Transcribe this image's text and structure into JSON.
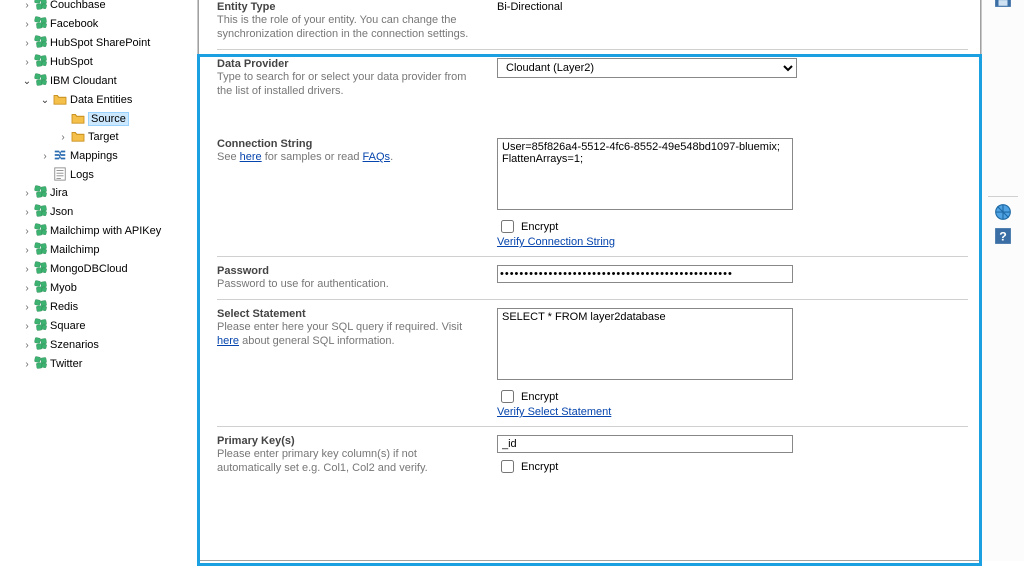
{
  "tree": {
    "nodes": [
      {
        "label": "Couchbase",
        "icon": "green",
        "expandable": true
      },
      {
        "label": "Facebook",
        "icon": "green",
        "expandable": true
      },
      {
        "label": "HubSpot SharePoint",
        "icon": "green",
        "expandable": true
      },
      {
        "label": "HubSpot",
        "icon": "green",
        "expandable": true
      },
      {
        "label": "IBM Cloudant",
        "icon": "green",
        "expandable": true,
        "open": true,
        "children": [
          {
            "label": "Data Entities",
            "icon": "folder",
            "expandable": true,
            "open": true,
            "children": [
              {
                "label": "Source",
                "icon": "folder",
                "selected": true
              },
              {
                "label": "Target",
                "icon": "folder",
                "expandable": true
              }
            ]
          },
          {
            "label": "Mappings",
            "icon": "map",
            "expandable": true
          },
          {
            "label": "Logs",
            "icon": "log",
            "expandable": false
          }
        ]
      },
      {
        "label": "Jira",
        "icon": "green",
        "expandable": true
      },
      {
        "label": "Json",
        "icon": "green",
        "expandable": true
      },
      {
        "label": "Mailchimp with APIKey",
        "icon": "green",
        "expandable": true
      },
      {
        "label": "Mailchimp",
        "icon": "green",
        "expandable": true
      },
      {
        "label": "MongoDBCloud",
        "icon": "green",
        "expandable": true
      },
      {
        "label": "Myob",
        "icon": "green",
        "expandable": true
      },
      {
        "label": "Redis",
        "icon": "green",
        "expandable": true
      },
      {
        "label": "Square",
        "icon": "green",
        "expandable": true
      },
      {
        "label": "Szenarios",
        "icon": "green",
        "expandable": true
      },
      {
        "label": "Twitter",
        "icon": "green",
        "expandable": true
      }
    ]
  },
  "form": {
    "entity_type": {
      "title": "Entity Type",
      "desc": "This is the role of your entity. You can change the synchronization direction in the connection settings.",
      "value": "Bi-Directional"
    },
    "data_provider": {
      "title": "Data Provider",
      "desc": "Type to search for or select your data provider from the list of installed drivers.",
      "selected": "Cloudant (Layer2)"
    },
    "connection_string": {
      "title": "Connection String",
      "desc_prefix": "See ",
      "link1": "here",
      "desc_mid": " for samples or read ",
      "link2": "FAQs",
      "desc_suffix": ".",
      "value": "User=85f826a4-5512-4fc6-8552-49e548bd1097-bluemix;\nFlattenArrays=1;",
      "encrypt_label": "Encrypt",
      "verify_label": "Verify Connection String"
    },
    "password": {
      "title": "Password",
      "desc": "Password to use for authentication.",
      "value": "••••••••••••••••••••••••••••••••••••••••••••••••"
    },
    "select_stmt": {
      "title": "Select Statement",
      "desc_prefix": "Please enter here your SQL query if required. Visit ",
      "link1": "here",
      "desc_suffix": " about general SQL information.",
      "value": "SELECT * FROM layer2database",
      "encrypt_label": "Encrypt",
      "verify_label": "Verify Select Statement"
    },
    "primary_keys": {
      "title": "Primary Key(s)",
      "desc": "Please enter primary key column(s) if not automatically set e.g. Col1, Col2 and verify.",
      "value": "_id",
      "encrypt_label": "Encrypt"
    }
  },
  "rightbar": {
    "icons": [
      "save-icon",
      "globe-icon",
      "help-icon"
    ]
  }
}
